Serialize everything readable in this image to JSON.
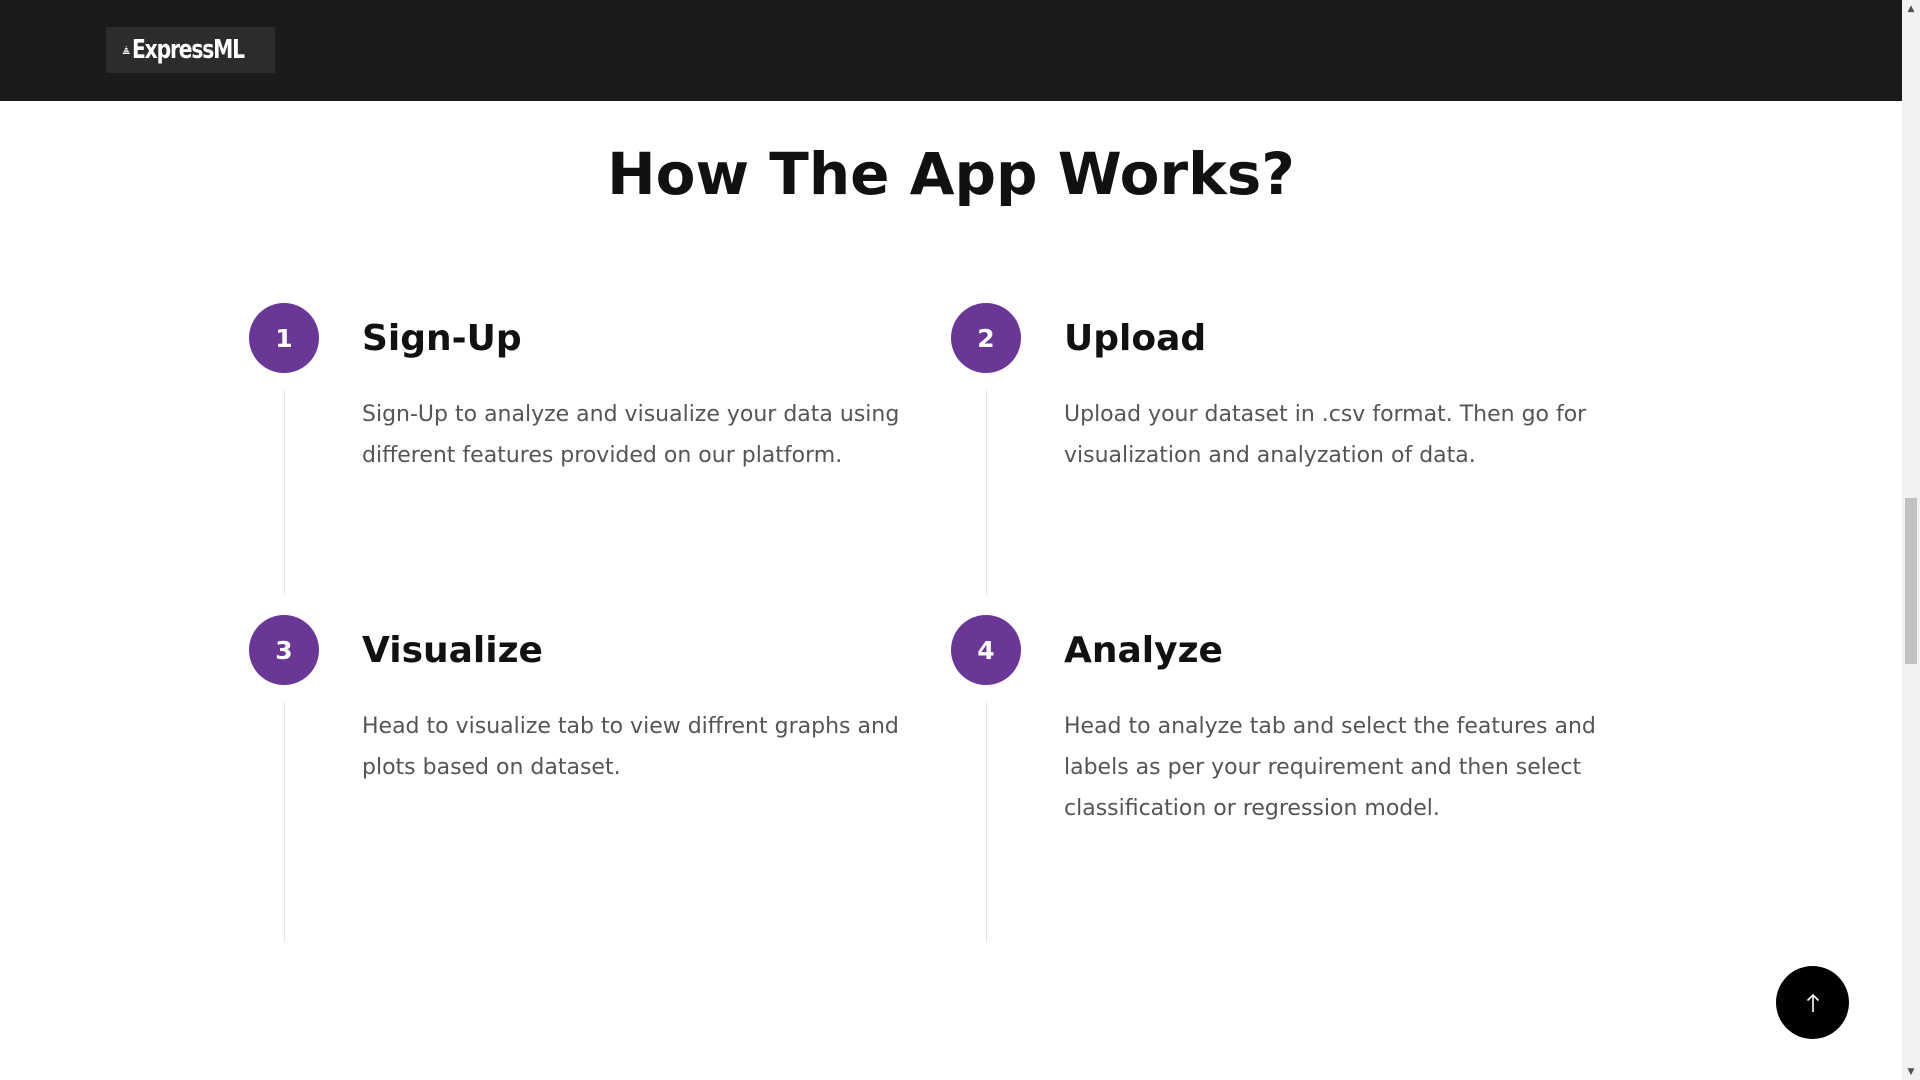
{
  "header": {
    "brand_name": "ExpressML"
  },
  "section": {
    "title": "How The App Works?"
  },
  "steps": [
    {
      "number": "1",
      "title": "Sign-Up",
      "description": "Sign-Up to analyze and visualize your data using different features provided on our platform."
    },
    {
      "number": "2",
      "title": "Upload",
      "description": "Upload your dataset in .csv format. Then go for visualization and analyzation of data."
    },
    {
      "number": "3",
      "title": "Visualize",
      "description": "Head to visualize tab to view diffrent graphs and plots based on dataset."
    },
    {
      "number": "4",
      "title": "Analyze",
      "description": "Head to analyze tab and select the features and labels as per your requirement and then select classification or regression model."
    }
  ],
  "colors": {
    "header_bg": "#1b1b1d",
    "accent": "#6a3797",
    "back_to_top_bg": "#000000"
  },
  "icons": {
    "brand": "pyramid-icon",
    "back_to_top": "arrow-up-icon"
  }
}
